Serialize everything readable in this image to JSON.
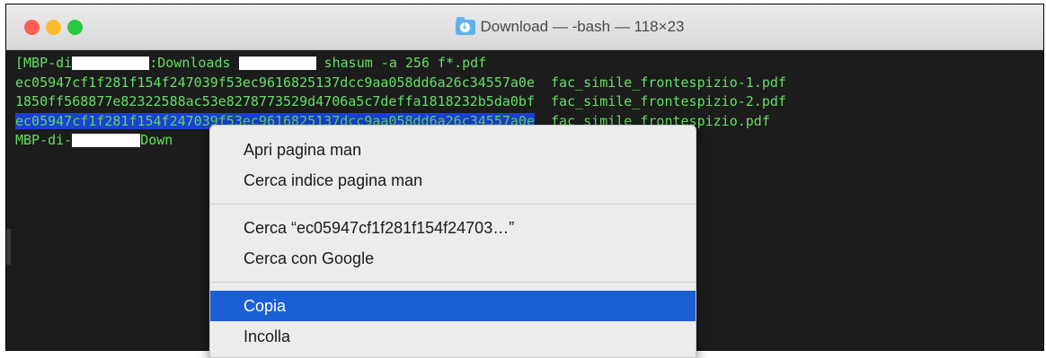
{
  "window": {
    "title": "Download — -bash — 118×23"
  },
  "terminal": {
    "line1": {
      "prefix": "[MBP-di",
      "mid": ":Downloads ",
      "cmd": " shasum -a 256 f*.pdf"
    },
    "rows": [
      {
        "hash": "ec05947cf1f281f154f247039f53ec9616825137dcc9aa058dd6a26c34557a0e",
        "file": "fac_simile_frontespizio-1.pdf"
      },
      {
        "hash": "1850ff568877e82322588ac53e8278773529d4706a5c7deffa1818232b5da0bf",
        "file": "fac_simile_frontespizio-2.pdf"
      },
      {
        "hash": "ec05947cf1f281f154f247039f53ec9616825137dcc9aa058dd6a26c34557a0e",
        "file": "fac_simile_frontespizio.pdf"
      }
    ],
    "line5": {
      "prefix": "MBP-di-",
      "rest": "Down"
    }
  },
  "menu": {
    "items": [
      {
        "label": "Apri pagina man"
      },
      {
        "label": "Cerca indice pagina man"
      },
      {
        "label": "Cerca “ec05947cf1f281f154f24703…”"
      },
      {
        "label": "Cerca con Google"
      },
      {
        "label": "Copia",
        "highlighted": true
      },
      {
        "label": "Incolla"
      }
    ]
  },
  "colors": {
    "terminal_text": "#64e064",
    "selection": "#1c3fd6",
    "menu_highlight": "#1a5fd6"
  },
  "icons": {
    "folder": "folder-icon"
  }
}
